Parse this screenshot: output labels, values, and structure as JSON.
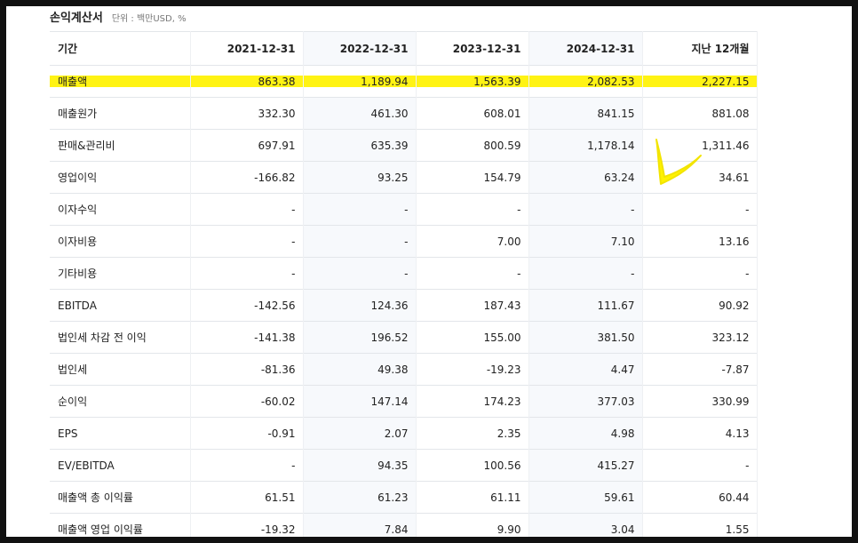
{
  "statement": {
    "title": "손익계산서",
    "unit": "단위 : 백만USD, %"
  },
  "table": {
    "headers": [
      "기간",
      "2021-12-31",
      "2022-12-31",
      "2023-12-31",
      "2024-12-31",
      "지난 12개월"
    ],
    "rows": [
      {
        "label": "매출액",
        "values": [
          "863.38",
          "1,189.94",
          "1,563.39",
          "2,082.53",
          "2,227.15"
        ],
        "highlighted": true
      },
      {
        "label": "매출원가",
        "values": [
          "332.30",
          "461.30",
          "608.01",
          "841.15",
          "881.08"
        ]
      },
      {
        "label": "판매&관리비",
        "values": [
          "697.91",
          "635.39",
          "800.59",
          "1,178.14",
          "1,311.46"
        ]
      },
      {
        "label": "영업이익",
        "values": [
          "-166.82",
          "93.25",
          "154.79",
          "63.24",
          "34.61"
        ]
      },
      {
        "label": "이자수익",
        "values": [
          "-",
          "-",
          "-",
          "-",
          "-"
        ]
      },
      {
        "label": "이자비용",
        "values": [
          "-",
          "-",
          "7.00",
          "7.10",
          "13.16"
        ]
      },
      {
        "label": "기타비용",
        "values": [
          "-",
          "-",
          "-",
          "-",
          "-"
        ]
      },
      {
        "label": "EBITDA",
        "values": [
          "-142.56",
          "124.36",
          "187.43",
          "111.67",
          "90.92"
        ]
      },
      {
        "label": "법인세 차감 전 이익",
        "values": [
          "-141.38",
          "196.52",
          "155.00",
          "381.50",
          "323.12"
        ]
      },
      {
        "label": "법인세",
        "values": [
          "-81.36",
          "49.38",
          "-19.23",
          "4.47",
          "-7.87"
        ]
      },
      {
        "label": "순이익",
        "values": [
          "-60.02",
          "147.14",
          "174.23",
          "377.03",
          "330.99"
        ]
      },
      {
        "label": "EPS",
        "values": [
          "-0.91",
          "2.07",
          "2.35",
          "4.98",
          "4.13"
        ]
      },
      {
        "label": "EV/EBITDA",
        "values": [
          "-",
          "94.35",
          "100.56",
          "415.27",
          "-"
        ]
      },
      {
        "label": "매출액 총 이익률",
        "values": [
          "61.51",
          "61.23",
          "61.11",
          "59.61",
          "60.44"
        ]
      },
      {
        "label": "매출액 영업 이익률",
        "values": [
          "-19.32",
          "7.84",
          "9.90",
          "3.04",
          "1.55"
        ]
      }
    ]
  },
  "colors": {
    "highlight": "#fff200",
    "shaded_column": "#f7f9fc"
  }
}
